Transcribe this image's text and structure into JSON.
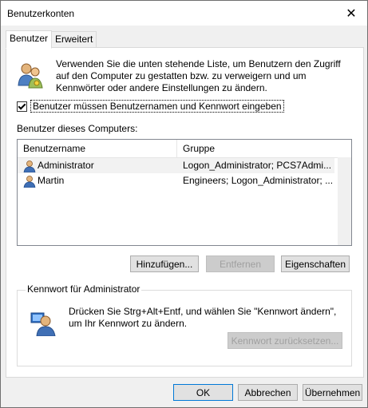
{
  "window": {
    "title": "Benutzerkonten",
    "close_glyph": "✕"
  },
  "tabs": [
    {
      "label": "Benutzer",
      "active": true
    },
    {
      "label": "Erweitert",
      "active": false
    }
  ],
  "intro_text": "Verwenden Sie die unten stehende Liste, um Benutzern den Zugriff auf den Computer zu gestatten bzw. zu verweigern und um Kennwörter oder andere Einstellungen zu ändern.",
  "checkbox": {
    "label": "Benutzer müssen Benutzernamen und Kennwort eingeben",
    "checked": true
  },
  "users_label": "Benutzer dieses Computers:",
  "table": {
    "columns": [
      "Benutzername",
      "Gruppe"
    ],
    "rows": [
      {
        "name": "Administrator",
        "group": "Logon_Administrator; PCS7Admi...",
        "selected": true
      },
      {
        "name": "Martin",
        "group": "Engineers; Logon_Administrator; ...",
        "selected": false
      }
    ]
  },
  "buttons": {
    "add": "Hinzufügen...",
    "remove": "Entfernen",
    "properties": "Eigenschaften"
  },
  "admin_group": {
    "label": "Kennwort für Administrator",
    "text": "Drücken Sie Strg+Alt+Entf, und wählen Sie \"Kennwort ändern\", um Ihr Kennwort zu ändern.",
    "reset_button": "Kennwort zurücksetzen..."
  },
  "footer": {
    "ok": "OK",
    "cancel": "Abbrechen",
    "apply": "Übernehmen"
  },
  "icons": {
    "users": "users-icon",
    "user": "user-icon",
    "admin": "admin-user-icon",
    "close": "close-icon"
  },
  "colors": {
    "accent": "#0078d7",
    "selection": "#f2f2f2"
  }
}
